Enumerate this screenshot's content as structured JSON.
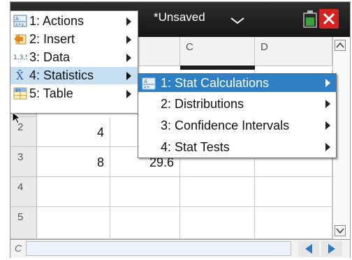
{
  "title_bar": {
    "document_title": "*Unsaved",
    "dropdown_icon": "chevron-down-icon",
    "battery_icon": "battery-icon",
    "close_icon": "close-icon",
    "colors": {
      "bar": "#1d1d1d",
      "close": "#d62222",
      "battery": "#3aa23a"
    }
  },
  "main_menu": {
    "items": [
      {
        "label": "1: Actions",
        "icon": "actions-icon"
      },
      {
        "label": "2: Insert",
        "icon": "insert-icon"
      },
      {
        "label": "3: Data",
        "icon": "data-icon",
        "icon_text": "1,3,5"
      },
      {
        "label": "4: Statistics",
        "icon": "statistics-icon",
        "icon_text": "X̄",
        "selected": true
      },
      {
        "label": "5: Table",
        "icon": "table-icon",
        "icon_text": "XY"
      }
    ],
    "selected_color": "#c6e0f2"
  },
  "sub_menu": {
    "items": [
      {
        "label": "1: Stat Calculations",
        "icon": "stat-calculations-icon",
        "selected": true
      },
      {
        "label": "2: Distributions"
      },
      {
        "label": "3: Confidence Intervals"
      },
      {
        "label": "4: Stat Tests"
      }
    ],
    "selected_color": "#2e7fc4"
  },
  "spreadsheet": {
    "column_headers": [
      "C",
      "D"
    ],
    "rows": [
      {
        "num": "2",
        "col_a": "4",
        "col_b": ""
      },
      {
        "num": "3",
        "col_a": "8",
        "col_b": "29.6"
      },
      {
        "num": "4",
        "col_a": "",
        "col_b": ""
      },
      {
        "num": "5",
        "col_a": "",
        "col_b": ""
      }
    ]
  },
  "formula_bar": {
    "label": "C",
    "value": "",
    "nav_left_icon": "arrow-left-icon",
    "nav_right_icon": "arrow-right-icon",
    "nav_color": "#2f78c0"
  }
}
